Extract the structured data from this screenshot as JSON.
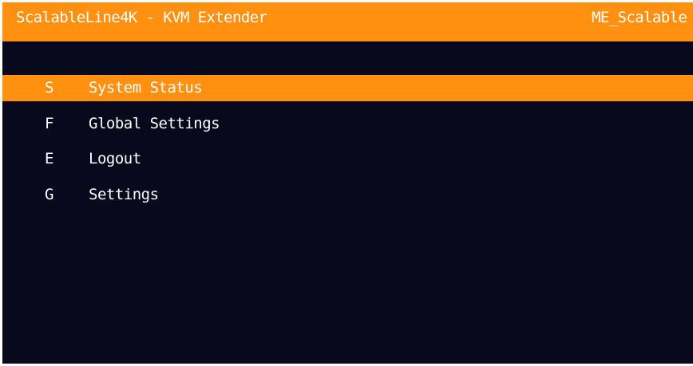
{
  "header": {
    "title": "ScalableLine4K - KVM Extender",
    "device_name": "ME_Scalable"
  },
  "menu": {
    "selected_index": 0,
    "items": [
      {
        "hotkey": "S",
        "label": "System Status"
      },
      {
        "hotkey": "F",
        "label": "Global Settings"
      },
      {
        "hotkey": "E",
        "label": "Logout"
      },
      {
        "hotkey": "G",
        "label": "Settings"
      }
    ]
  },
  "colors": {
    "accent": "#ff9010",
    "background": "#08091c",
    "text": "#ffffff"
  }
}
